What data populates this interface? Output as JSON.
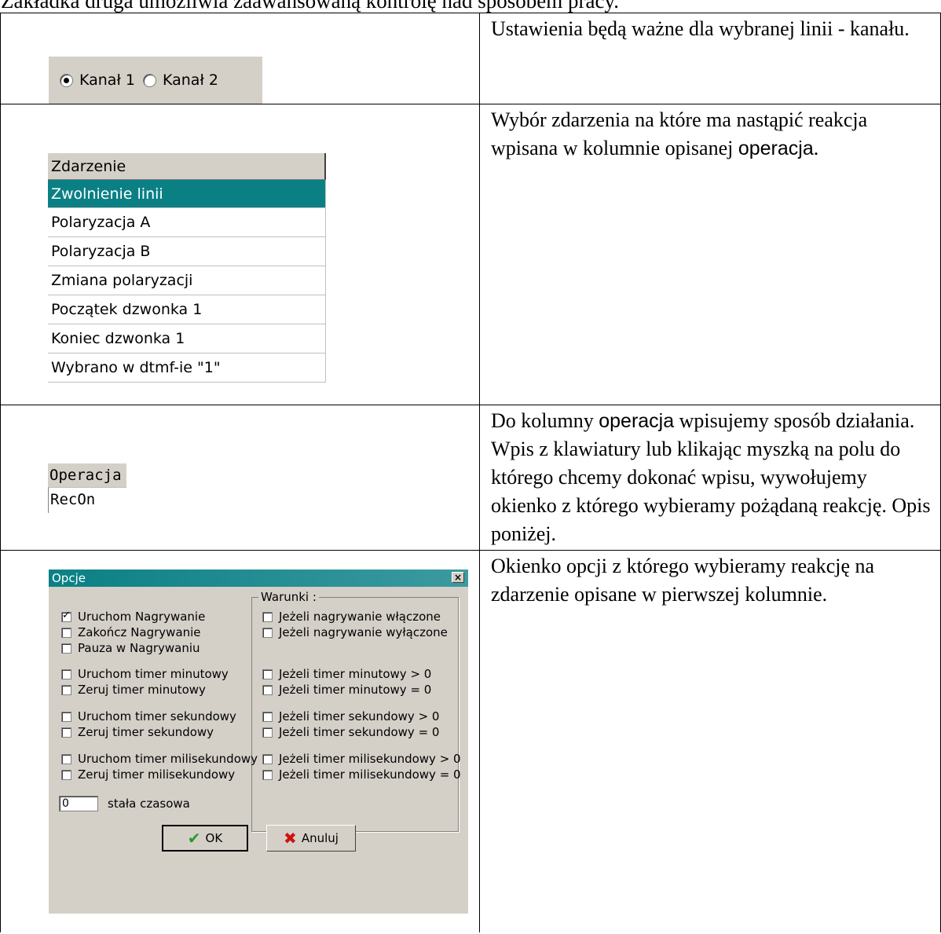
{
  "intro_text": "Zakładka druga umożliwia zaawansowaną kontrolę nad sposobem pracy.",
  "rows": {
    "channel": {
      "desc": "Ustawienia będą ważne dla wybranej linii - kanału.",
      "options": [
        {
          "label": "Kanał 1",
          "checked": true
        },
        {
          "label": "Kanał 2",
          "checked": false
        }
      ]
    },
    "event": {
      "desc_before": "Wybór zdarzenia na które ma nastąpić reakcja wpisana w kolumnie opisanej ",
      "desc_keyword": "operacja",
      "desc_after": ".",
      "header": "Zdarzenie",
      "items": [
        "Zwolnienie linii",
        "Polaryzacja A",
        "Polaryzacja B",
        "Zmiana polaryzacji",
        "Początek dzwonka 1",
        "Koniec dzwonka 1",
        "Wybrano w dtmf-ie \"1\""
      ],
      "selected_index": 0
    },
    "operation": {
      "desc_before": "Do kolumny ",
      "desc_keyword": "operacja",
      "desc_after": " wpisujemy sposób działania. Wpis z klawiatury lub klikając myszką na polu do którego chcemy dokonać wpisu, wywołujemy okienko z którego wybieramy pożądaną reakcję. Opis poniżej.",
      "header": "Operacja",
      "value": "RecOn"
    },
    "options": {
      "desc": "Okienko opcji z którego wybieramy reakcję na zdarzenie opisane w pierwszej kolumnie.",
      "dialog_title": "Opcje",
      "close_label": "×",
      "group_label": "Warunki :",
      "left_checkboxes": [
        {
          "label": "Uruchom Nagrywanie",
          "checked": true
        },
        {
          "label": "Zakończ Nagrywanie",
          "checked": false
        },
        {
          "label": "Pauza w Nagrywaniu",
          "checked": false
        },
        {
          "label": "Uruchom timer minutowy",
          "checked": false
        },
        {
          "label": "Zeruj timer minutowy",
          "checked": false
        },
        {
          "label": "Uruchom timer sekundowy",
          "checked": false
        },
        {
          "label": "Zeruj timer sekundowy",
          "checked": false
        },
        {
          "label": "Uruchom timer milisekundowy",
          "checked": false
        },
        {
          "label": "Zeruj timer milisekundowy",
          "checked": false
        }
      ],
      "right_checkboxes": [
        {
          "label": "Jeżeli nagrywanie włączone",
          "checked": false
        },
        {
          "label": "Jeżeli nagrywanie wyłączone",
          "checked": false
        },
        {
          "label": "Jeżeli timer minutowy > 0",
          "checked": false
        },
        {
          "label": "Jeżeli timer minutowy = 0",
          "checked": false
        },
        {
          "label": "Jeżeli timer sekundowy > 0",
          "checked": false
        },
        {
          "label": "Jeżeli timer sekundowy = 0",
          "checked": false
        },
        {
          "label": "Jeżeli timer milisekundowy > 0",
          "checked": false
        },
        {
          "label": "Jeżeli timer milisekundowy = 0",
          "checked": false
        }
      ],
      "time_constant_value": "0",
      "time_constant_label": "stała czasowa",
      "ok_label": "OK",
      "cancel_label": "Anuluj",
      "ok_icon": "checkmark-icon",
      "cancel_icon": "x-cross-icon"
    }
  },
  "colors": {
    "selection": "#0a8085",
    "dialog_bg": "#d4d0c8"
  }
}
